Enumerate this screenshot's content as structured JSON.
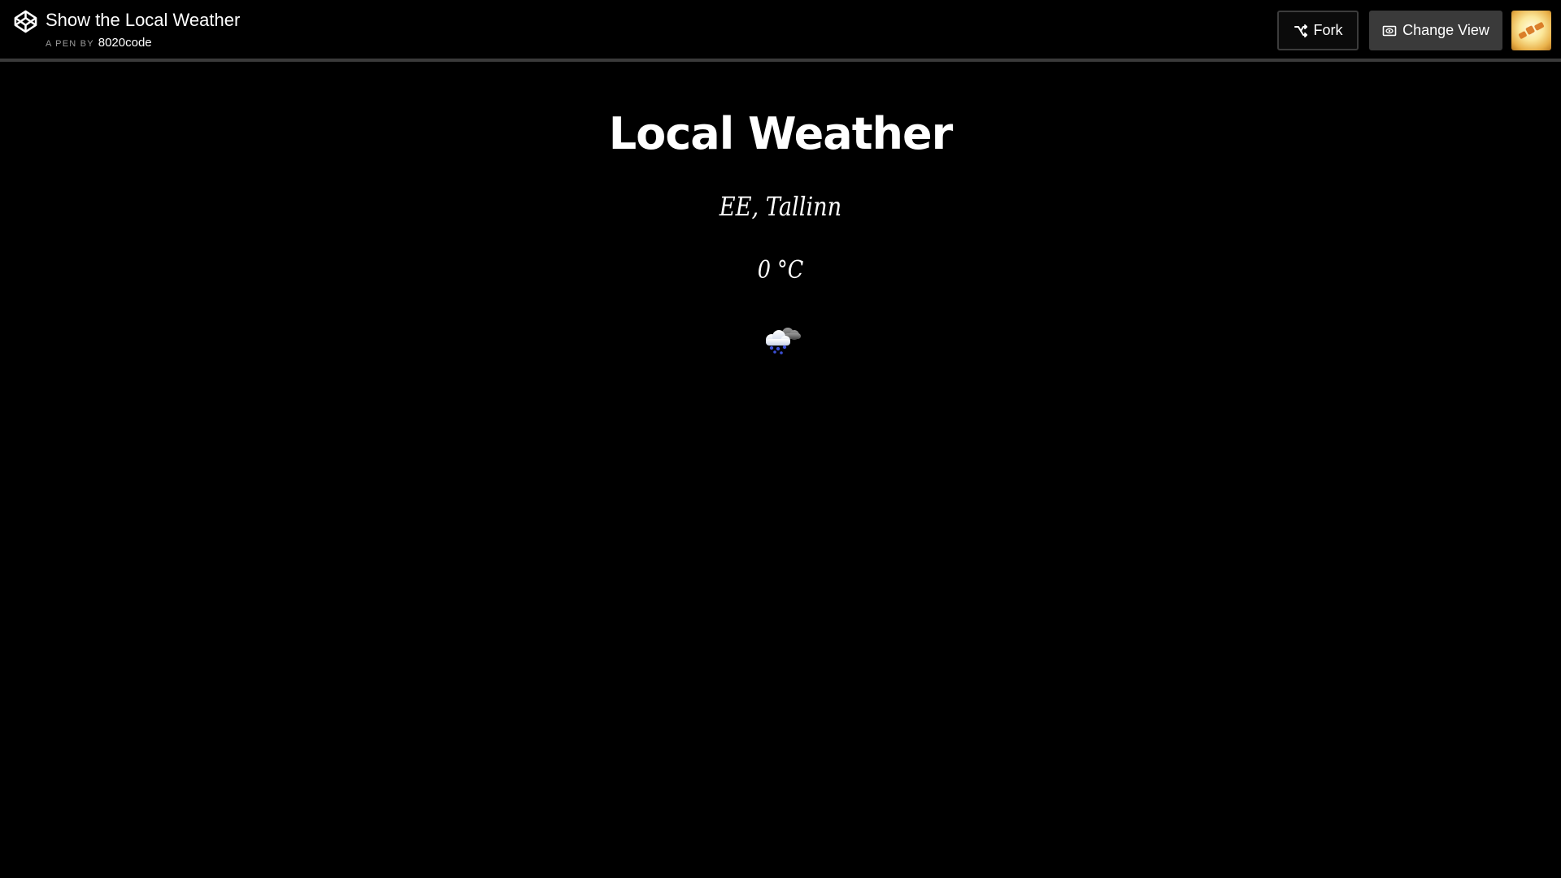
{
  "header": {
    "title": "Show the Local Weather",
    "by_label": "A PEN BY",
    "author": "8020code",
    "fork_label": "Fork",
    "change_view_label": "Change View"
  },
  "weather": {
    "title": "Local Weather",
    "location": "EE, Tallinn",
    "temperature": "0 °C",
    "icon": "snow-cloud-icon"
  },
  "colors": {
    "background": "#000000",
    "text": "#ffffff",
    "header_divider": "#3a3a3a",
    "button_dark": "#3a3a3a",
    "byline_muted": "#9a9a9a"
  },
  "icons": {
    "logo": "codepen-logo-icon",
    "fork": "fork-icon",
    "change_view": "change-view-icon",
    "avatar": "avatar"
  }
}
